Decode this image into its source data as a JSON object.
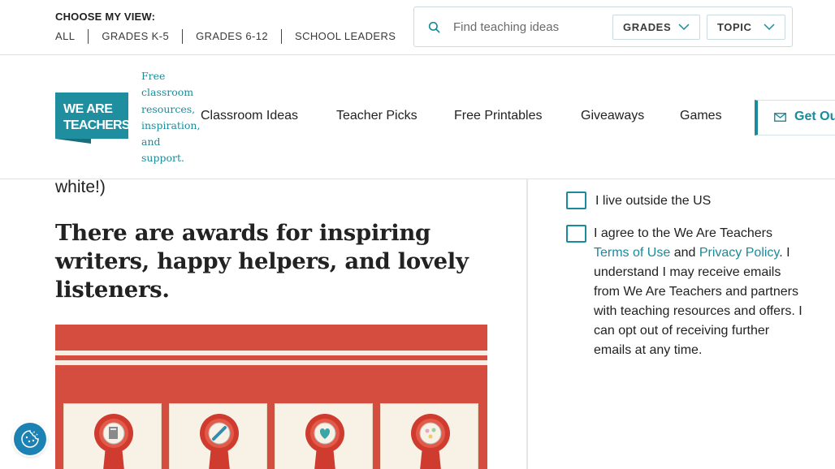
{
  "top_bar": {
    "view_label": "CHOOSE MY VIEW:",
    "views": [
      "ALL",
      "GRADES K-5",
      "GRADES 6-12",
      "SCHOOL LEADERS"
    ],
    "search": {
      "placeholder": "Find teaching ideas",
      "value": ""
    },
    "filters": {
      "grades": "GRADES",
      "topic": "TOPIC"
    }
  },
  "nav": {
    "logo_text": "WE ARE TEACHERS",
    "tagline": "Free classroom resources, inspiration, and support.",
    "links": [
      "Classroom Ideas",
      "Teacher Picks",
      "Free Printables",
      "Giveaways",
      "Games"
    ],
    "cta": "Get Ou"
  },
  "article": {
    "fragment": "white!)",
    "heading": "There are awards for inspiring writers, happy helpers, and lovely listeners."
  },
  "sidebar": {
    "outside_us_label": "I live outside the US",
    "consent": {
      "prefix": "I agree to the We Are Teachers ",
      "terms_link": "Terms of Use",
      "and": " and ",
      "privacy_link": "Privacy Policy",
      "suffix": ". I understand I may receive emails from We Are Teachers and partners with teaching resources and offers. I can opt out of receiving further emails at any time."
    }
  },
  "colors": {
    "accent": "#1b8a9a",
    "logo_bg": "#1f8fa0",
    "illustration_bg": "#d44d3e",
    "cookie_button": "#1b82b3"
  }
}
